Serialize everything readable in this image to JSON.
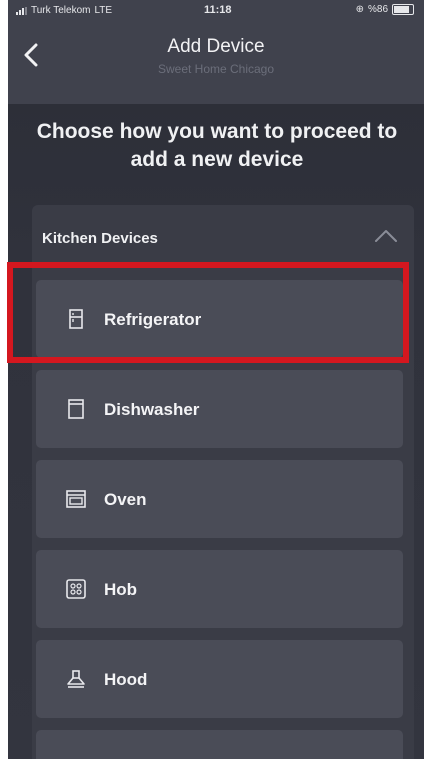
{
  "status_bar": {
    "carrier": "Turk Telekom",
    "network": "LTE",
    "time": "11:18",
    "battery": "%86"
  },
  "header": {
    "title": "Add Device",
    "subtitle": "Sweet Home Chicago"
  },
  "heading": "Choose how you want to proceed to add a new device",
  "section": {
    "title": "Kitchen Devices",
    "items": [
      {
        "label": "Refrigerator",
        "icon": "refrigerator-icon"
      },
      {
        "label": "Dishwasher",
        "icon": "dishwasher-icon"
      },
      {
        "label": "Oven",
        "icon": "oven-icon"
      },
      {
        "label": "Hob",
        "icon": "hob-icon"
      },
      {
        "label": "Hood",
        "icon": "hood-icon"
      }
    ]
  },
  "colors": {
    "highlight": "#d4171f",
    "header_bg": "#40424d",
    "card_bg": "#4a4c57"
  }
}
